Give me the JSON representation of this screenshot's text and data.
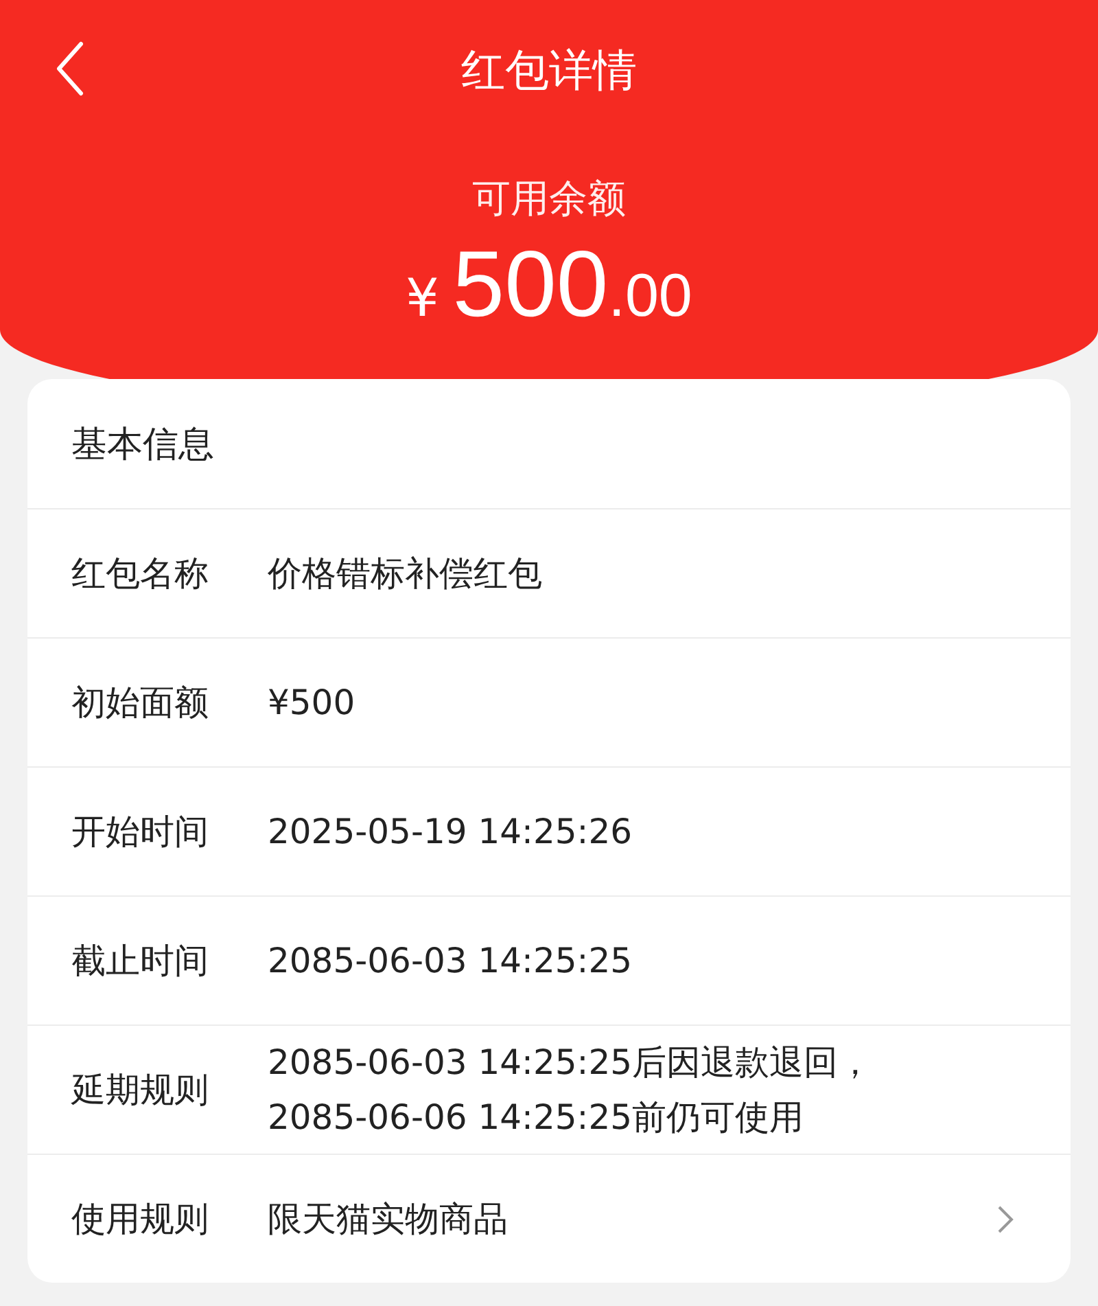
{
  "header": {
    "title": "红包详情",
    "balance_label": "可用余额",
    "amount": {
      "currency": "¥",
      "integer": "500",
      "decimal": ".00"
    }
  },
  "card": {
    "title": "基本信息",
    "rows": [
      {
        "kind": "text",
        "label": "红包名称",
        "value": "价格错标补偿红包"
      },
      {
        "kind": "text",
        "label": "初始面额",
        "value": "¥500"
      },
      {
        "kind": "text",
        "label": "开始时间",
        "value": "2025-05-19 14:25:26"
      },
      {
        "kind": "text",
        "label": "截止时间",
        "value": "2085-06-03 14:25:25"
      },
      {
        "kind": "multiline",
        "label": "延期规则",
        "lines": [
          "2085-06-03 14:25:25后因退款退回，",
          "2085-06-06 14:25:25前仍可使用"
        ]
      },
      {
        "kind": "link",
        "label": "使用规则",
        "value": "限天猫实物商品"
      }
    ]
  }
}
